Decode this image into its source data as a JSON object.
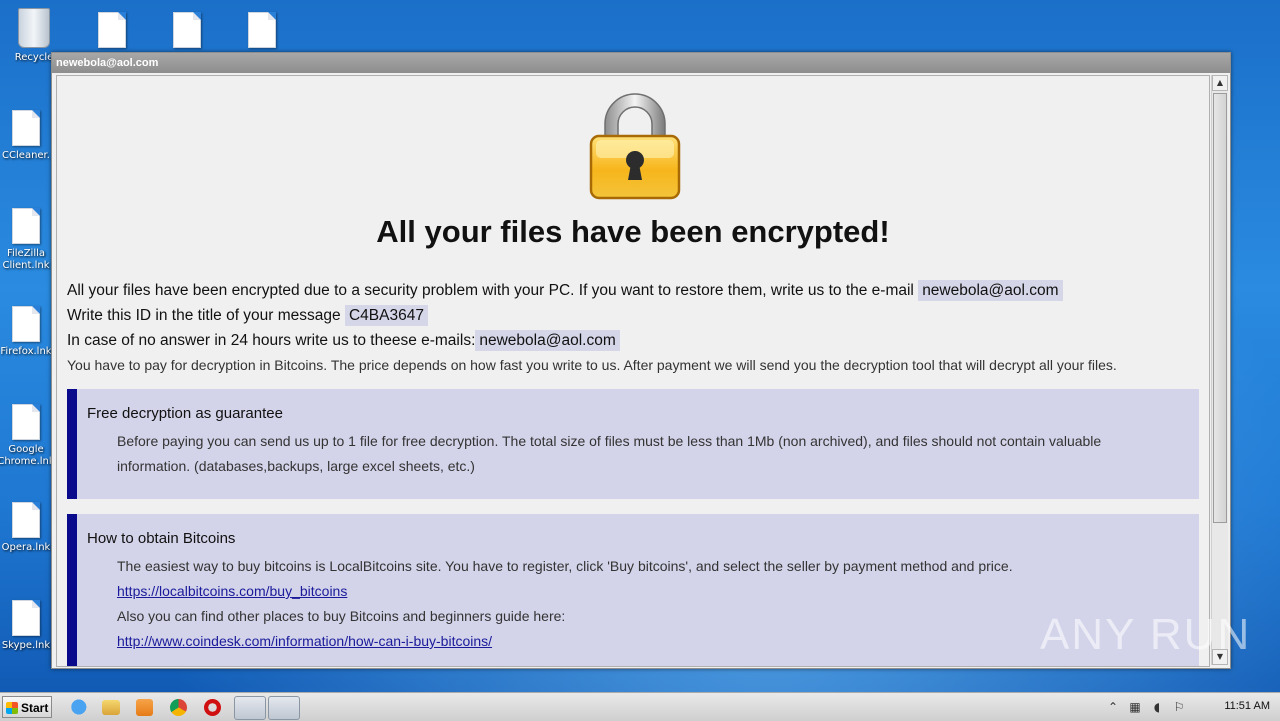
{
  "desktop": {
    "icons": [
      {
        "label": "Recycle",
        "icon": "recycle-bin-icon"
      },
      {
        "label": "",
        "icon": "file-icon"
      },
      {
        "label": "",
        "icon": "file-icon"
      },
      {
        "label": "",
        "icon": "file-icon"
      },
      {
        "label": "CCleaner.",
        "icon": "file-icon"
      },
      {
        "label": "FileZilla",
        "label2": "Client.lnk",
        "icon": "file-icon"
      },
      {
        "label": "Firefox.lnk",
        "icon": "file-icon"
      },
      {
        "label": "Google",
        "label2": "Chrome.lnk",
        "icon": "file-icon"
      },
      {
        "label": "Opera.lnk",
        "icon": "file-icon"
      },
      {
        "label": "Skype.lnk",
        "icon": "file-icon"
      }
    ]
  },
  "window": {
    "title": "newebola@aol.com",
    "headline": "All your files have been encrypted!",
    "lines": {
      "l1_text": "All your files have been encrypted due to a security problem with your PC. If you want to restore them, write us to the e-mail",
      "l1_email": "newebola@aol.com",
      "l2_text": "Write this ID in the title of your message",
      "l2_id": "C4BA3647",
      "l3_text": "In case of no answer in 24 hours write us to theese e-mails:",
      "l3_email": "newebola@aol.com",
      "l4_text": "You have to pay for decryption in Bitcoins. The price depends on how fast you write to us. After payment we will send you the decryption tool that will decrypt all your files."
    },
    "box1": {
      "title": "Free decryption as guarantee",
      "body1": "Before paying you can send us up to 1 file for free decryption. The total size of files must be less than 1Mb (non archived), and files should not contain valuable",
      "body2": "information. (databases,backups, large excel sheets, etc.)"
    },
    "box2": {
      "title": "How to obtain Bitcoins",
      "body1": "The easiest way to buy bitcoins is LocalBitcoins site. You have to register, click 'Buy bitcoins', and select the seller by payment method and price.",
      "link1": "https://localbitcoins.com/buy_bitcoins",
      "body2": "Also you can find other places to buy Bitcoins and beginners guide here:",
      "link2": "http://www.coindesk.com/information/how-can-i-buy-bitcoins/"
    }
  },
  "watermark": "ANY RUN",
  "taskbar": {
    "start_label": "Start",
    "clock": "11:51 AM",
    "icons": [
      "ie-icon",
      "explorer-folder-icon",
      "media-player-icon",
      "chrome-icon",
      "opera-icon",
      "app-window-icon",
      "app-window-icon"
    ]
  }
}
